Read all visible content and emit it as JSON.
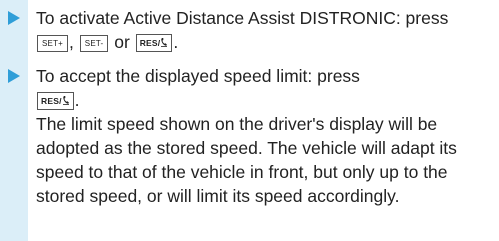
{
  "steps": [
    {
      "text_before": "To activate Active Distance Assist DISTRONIC: press",
      "key1": "SET+",
      "sep1": ",",
      "key2": "SET-",
      "sep2": "or",
      "key3": "RES/",
      "end": "."
    },
    {
      "text_before": "To accept the displayed speed limit: press",
      "key1": "RES/",
      "end": ".",
      "paragraph": "The limit speed shown on the driver's display will be adopted as the stored speed. The vehicle will adapt its speed to that of the vehicle in front, but only up to the stored speed, or will limit its speed accordingly."
    }
  ],
  "colors": {
    "accent": "#2f9ed8",
    "sidebar": "#dbeef8"
  },
  "icons": [
    "bullet-triangle-icon",
    "phone-icon"
  ]
}
